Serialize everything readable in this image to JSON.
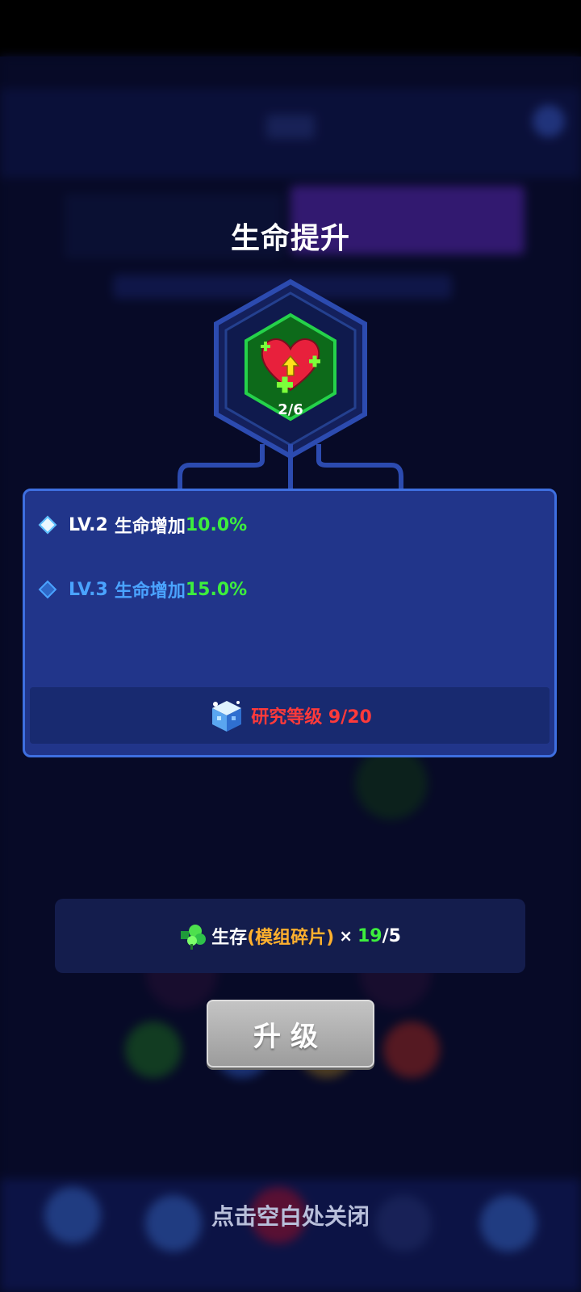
{
  "popup": {
    "title": "生命提升",
    "icon": "heart-up-icon",
    "progress_text": "2/6",
    "levels": [
      {
        "tag": "LV.2",
        "label": "生命增加",
        "value": "10.0%",
        "state": "current"
      },
      {
        "tag": "LV.3",
        "label": "生命增加",
        "value": "15.0%",
        "state": "next"
      }
    ],
    "requirement": {
      "icon": "research-cube-icon",
      "text": "研究等级 9/20"
    },
    "cost": {
      "icon": "clover-fragment-icon",
      "name": "生存",
      "sub": "(模组碎片)",
      "x": "×",
      "have": "19",
      "need": "/5"
    },
    "upgrade_label": "升级",
    "close_hint": "点击空白处关闭"
  },
  "colors": {
    "accent_green": "#3dee3d",
    "requirement_red": "#ff3a3a",
    "panel_bg": "#21358a",
    "panel_border": "#3e6fe0",
    "cost_orange": "#ffb02e"
  }
}
